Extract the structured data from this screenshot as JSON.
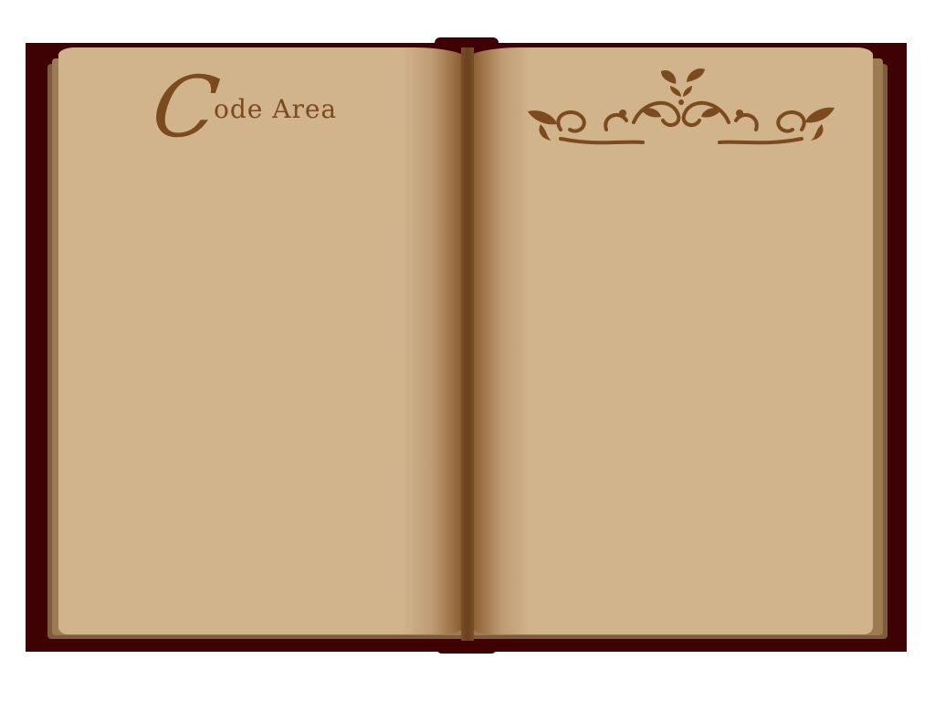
{
  "title": {
    "initial": "C",
    "rest": "ode Area"
  },
  "colors": {
    "cover": "#3e0204",
    "paper": "#d1b38c",
    "ink": "#7b4a1e"
  },
  "ornament": {
    "icon": "flourish-ornament-icon"
  }
}
